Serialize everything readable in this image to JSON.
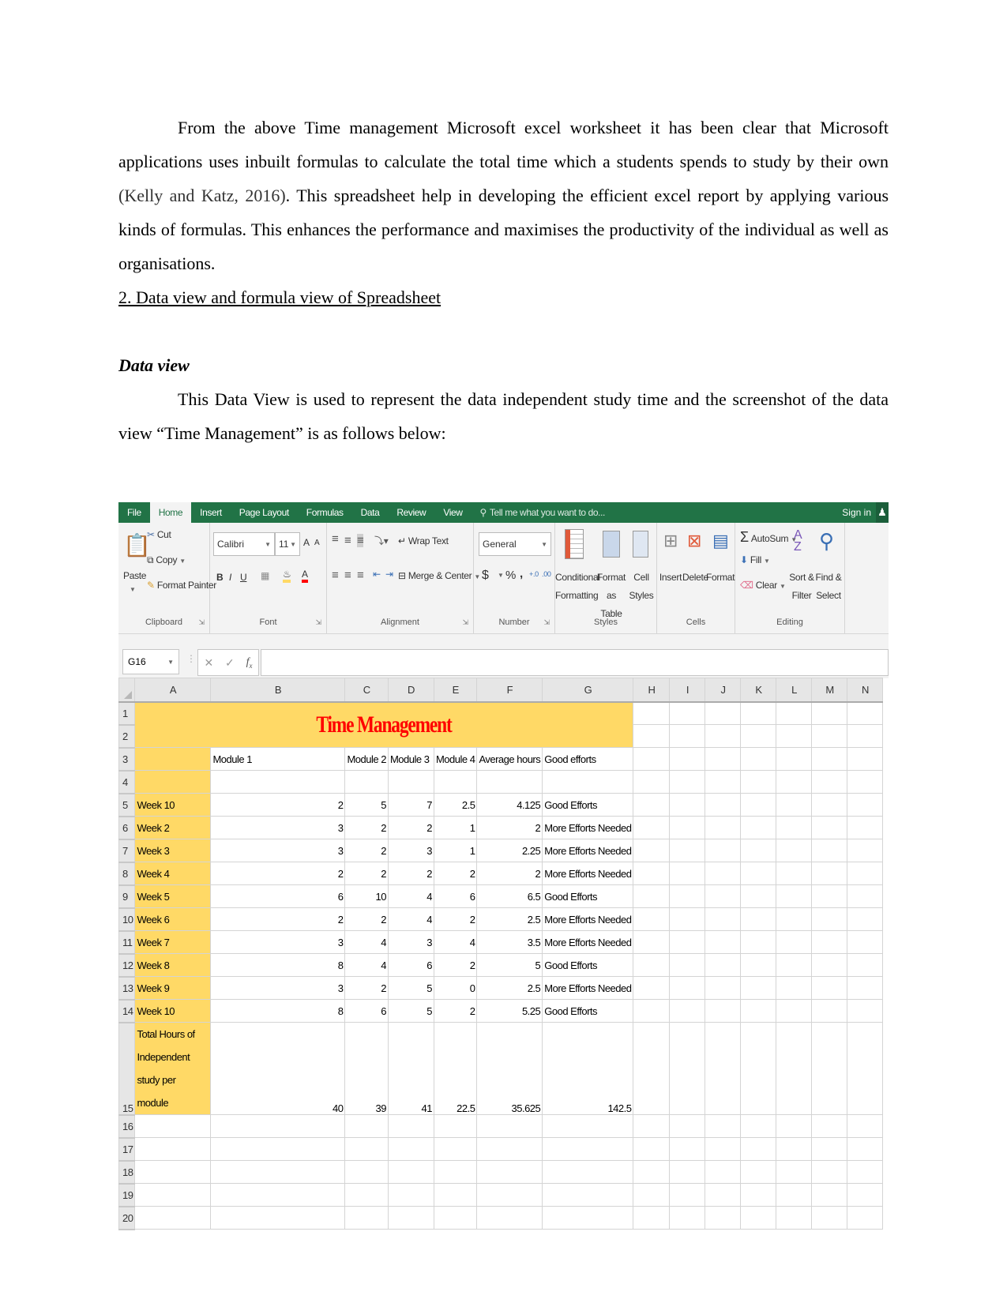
{
  "document": {
    "paragraph1": {
      "before_cite": "From the above Time management Microsoft excel worksheet it has been clear that Microsoft applications uses inbuilt formulas to calculate the total time which a students spends to study by their own ",
      "citation": "(Kelly and Katz, 2016)",
      "after_cite": ". This spreadsheet help in developing the efficient excel report by applying various kinds of formulas. This enhances the performance and maximises the productivity of the individual as well as organisations."
    },
    "section_heading": "2. Data view and formula view of Spreadsheet ",
    "subheading": "Data view",
    "paragraph2": "This Data View is used to represent the data independent study time and the screenshot of the data view “Time Management” is as follows below:"
  },
  "excel": {
    "tabs": [
      "File",
      "Home",
      "Insert",
      "Page Layout",
      "Formulas",
      "Data",
      "Review",
      "View"
    ],
    "active_tab": "Home",
    "tell_me": "Tell me what you want to do...",
    "sign_in": "Sign in",
    "ribbon": {
      "clipboard": {
        "label": "Clipboard",
        "paste": "Paste",
        "cut": "Cut",
        "copy": "Copy",
        "format_painter": "Format Painter"
      },
      "font": {
        "label": "Font",
        "font_name": "Calibri",
        "font_size": "11",
        "bold": "B",
        "italic": "I",
        "underline": "U",
        "grow": "A",
        "shrink": "A",
        "font_color": "A"
      },
      "alignment": {
        "label": "Alignment",
        "wrap_text": "Wrap Text",
        "merge_center": "Merge & Center"
      },
      "number": {
        "label": "Number",
        "format": "General",
        "currency": "$",
        "percent": "%",
        "comma": ",",
        "inc_decimal": "+.0",
        "dec_decimal": ".00"
      },
      "styles": {
        "label": "Styles",
        "conditional_1": "Conditional",
        "conditional_2": "Formatting",
        "format_table_1": "Format as",
        "format_table_2": "Table",
        "cell_styles_1": "Cell",
        "cell_styles_2": "Styles"
      },
      "cells": {
        "label": "Cells",
        "insert": "Insert",
        "delete": "Delete",
        "format": "Format"
      },
      "editing": {
        "label": "Editing",
        "autosum": "AutoSum",
        "fill": "Fill",
        "clear": "Clear",
        "sort_1": "Sort &",
        "sort_2": "Filter",
        "find_1": "Find &",
        "find_2": "Select"
      }
    },
    "name_box": "G16",
    "formula_value": "",
    "column_headers": [
      "A",
      "B",
      "C",
      "D",
      "E",
      "F",
      "G",
      "H",
      "I",
      "J",
      "K",
      "L",
      "M",
      "N"
    ],
    "sheet_title": "Time Management",
    "header_row": [
      "",
      "Module 1",
      "Module 2",
      "Module 3",
      "Module 4",
      "Average hours",
      "Good efforts"
    ],
    "rows": [
      {
        "n": "5",
        "week": "Week 10",
        "m1": "2",
        "m2": "5",
        "m3": "7",
        "m4": "2.5",
        "avg": "4.125",
        "effort": "Good Efforts"
      },
      {
        "n": "6",
        "week": "Week 2",
        "m1": "3",
        "m2": "2",
        "m3": "2",
        "m4": "1",
        "avg": "2",
        "effort": "More Efforts Needed"
      },
      {
        "n": "7",
        "week": "Week 3",
        "m1": "3",
        "m2": "2",
        "m3": "3",
        "m4": "1",
        "avg": "2.25",
        "effort": "More Efforts Needed"
      },
      {
        "n": "8",
        "week": "Week 4",
        "m1": "2",
        "m2": "2",
        "m3": "2",
        "m4": "2",
        "avg": "2",
        "effort": "More Efforts Needed"
      },
      {
        "n": "9",
        "week": "Week 5",
        "m1": "6",
        "m2": "10",
        "m3": "4",
        "m4": "6",
        "avg": "6.5",
        "effort": "Good Efforts"
      },
      {
        "n": "10",
        "week": "Week 6",
        "m1": "2",
        "m2": "2",
        "m3": "4",
        "m4": "2",
        "avg": "2.5",
        "effort": "More Efforts Needed"
      },
      {
        "n": "11",
        "week": "Week 7",
        "m1": "3",
        "m2": "4",
        "m3": "3",
        "m4": "4",
        "avg": "3.5",
        "effort": "More Efforts Needed"
      },
      {
        "n": "12",
        "week": "Week 8",
        "m1": "8",
        "m2": "4",
        "m3": "6",
        "m4": "2",
        "avg": "5",
        "effort": "Good Efforts"
      },
      {
        "n": "13",
        "week": "Week 9",
        "m1": "3",
        "m2": "2",
        "m3": "5",
        "m4": "0",
        "avg": "2.5",
        "effort": "More Efforts Needed"
      },
      {
        "n": "14",
        "week": "Week 10",
        "m1": "8",
        "m2": "6",
        "m3": "5",
        "m4": "2",
        "avg": "5.25",
        "effort": "Good Efforts"
      }
    ],
    "total_row": {
      "n": "15",
      "label": "Total Hours of Independent study per module",
      "m1": "40",
      "m2": "39",
      "m3": "41",
      "m4": "22.5",
      "avg": "35.625",
      "total": "142.5"
    },
    "empty_rows": [
      "16",
      "17",
      "18",
      "19",
      "20"
    ],
    "top_rows": [
      "1",
      "2",
      "3",
      "4"
    ],
    "colors": {
      "excel_green": "#217346",
      "highlight_yellow": "#ffd966",
      "title_red": "#ff0000"
    }
  }
}
